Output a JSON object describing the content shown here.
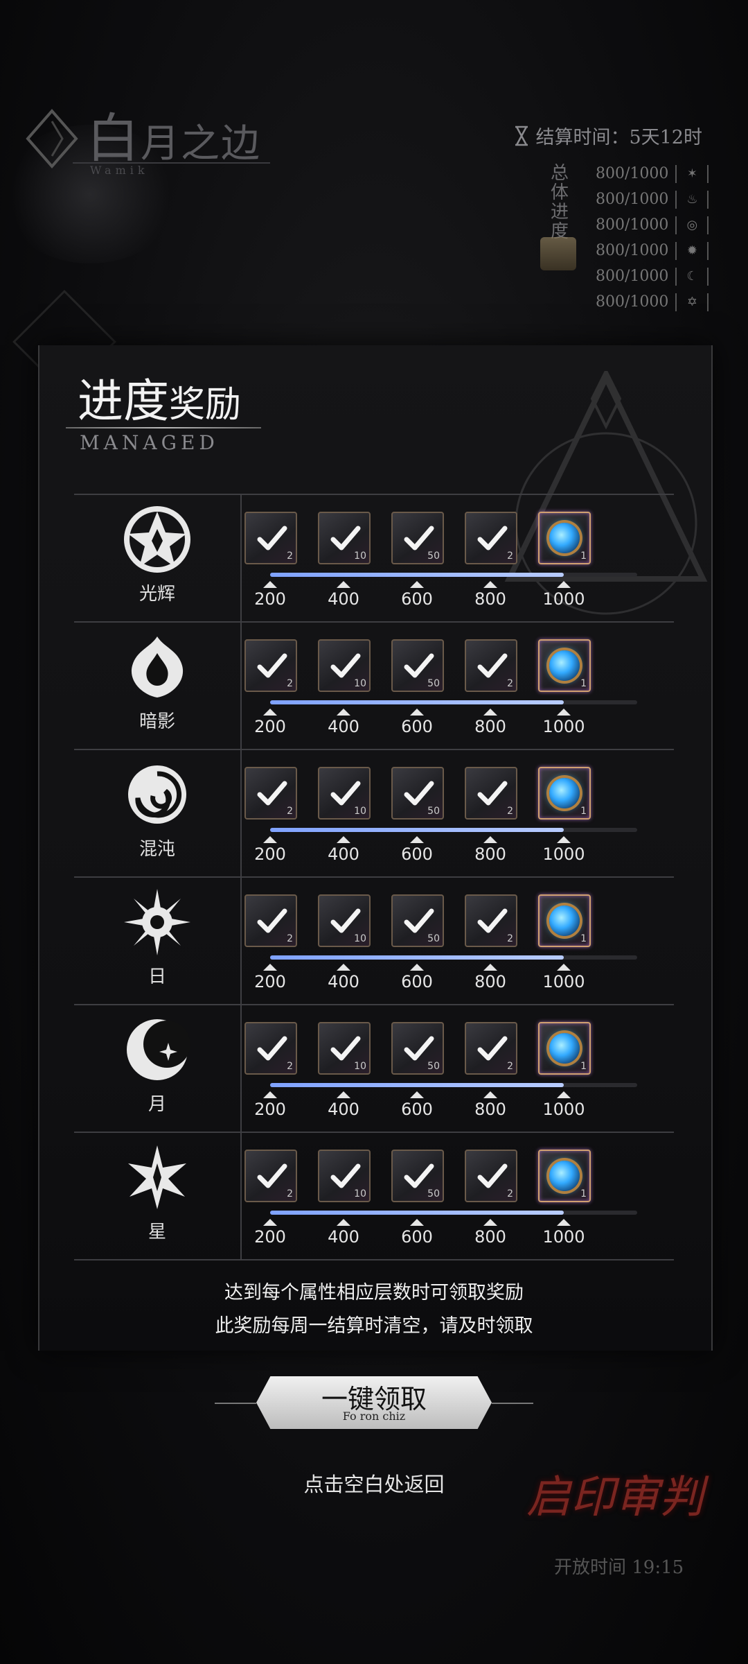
{
  "event": {
    "title_main": "白",
    "title_rest": "月之边",
    "subtitle": "Wamik",
    "settle_label": "结算时间：5天12时",
    "overall_label": "总体进度",
    "progress": [
      {
        "value": "800/1000",
        "icon": "radiance-icon"
      },
      {
        "value": "800/1000",
        "icon": "shadow-icon"
      },
      {
        "value": "800/1000",
        "icon": "chaos-icon"
      },
      {
        "value": "800/1000",
        "icon": "sun-icon"
      },
      {
        "value": "800/1000",
        "icon": "moon-icon"
      },
      {
        "value": "800/1000",
        "icon": "star-icon"
      }
    ]
  },
  "panel": {
    "title_big": "进度",
    "title_small": "奖励",
    "subtitle": "MANAGED",
    "rows": [
      {
        "name": "光辉",
        "icon": "radiance-icon",
        "progress": 0.8,
        "rewards": [
          {
            "qty": "2",
            "claimed": true
          },
          {
            "qty": "10",
            "claimed": true
          },
          {
            "qty": "50",
            "claimed": true
          },
          {
            "qty": "2",
            "claimed": true
          },
          {
            "qty": "1",
            "claimed": false
          }
        ]
      },
      {
        "name": "暗影",
        "icon": "shadow-icon",
        "progress": 0.8,
        "rewards": [
          {
            "qty": "2",
            "claimed": true
          },
          {
            "qty": "10",
            "claimed": true
          },
          {
            "qty": "50",
            "claimed": true
          },
          {
            "qty": "2",
            "claimed": true
          },
          {
            "qty": "1",
            "claimed": false
          }
        ]
      },
      {
        "name": "混沌",
        "icon": "chaos-icon",
        "progress": 0.8,
        "rewards": [
          {
            "qty": "2",
            "claimed": true
          },
          {
            "qty": "10",
            "claimed": true
          },
          {
            "qty": "50",
            "claimed": true
          },
          {
            "qty": "2",
            "claimed": true
          },
          {
            "qty": "1",
            "claimed": false
          }
        ]
      },
      {
        "name": "日",
        "icon": "sun-icon",
        "progress": 0.8,
        "rewards": [
          {
            "qty": "2",
            "claimed": true
          },
          {
            "qty": "10",
            "claimed": true
          },
          {
            "qty": "50",
            "claimed": true
          },
          {
            "qty": "2",
            "claimed": true
          },
          {
            "qty": "1",
            "claimed": false
          }
        ]
      },
      {
        "name": "月",
        "icon": "moon-icon",
        "progress": 0.8,
        "rewards": [
          {
            "qty": "2",
            "claimed": true
          },
          {
            "qty": "10",
            "claimed": true
          },
          {
            "qty": "50",
            "claimed": true
          },
          {
            "qty": "2",
            "claimed": true
          },
          {
            "qty": "1",
            "claimed": false
          }
        ]
      },
      {
        "name": "星",
        "icon": "star-icon",
        "progress": 0.8,
        "rewards": [
          {
            "qty": "2",
            "claimed": true
          },
          {
            "qty": "10",
            "claimed": true
          },
          {
            "qty": "50",
            "claimed": true
          },
          {
            "qty": "2",
            "claimed": true
          },
          {
            "qty": "1",
            "claimed": false
          }
        ]
      }
    ],
    "thresholds": [
      "200",
      "400",
      "600",
      "800",
      "1000"
    ],
    "note_line1": "达到每个属性相应层数时可领取奖励",
    "note_line2": "此奖励每周一结算时清空，请及时领取"
  },
  "claim_button": {
    "label": "一键领取",
    "sub": "Fo ron chiz"
  },
  "return_text": "点击空白处返回",
  "trial": {
    "logo": "启印审判",
    "open_time": "开放时间 19:15"
  },
  "colors": {
    "bar_fill": "#9fb8ff",
    "rare_border": "#e0a0f0",
    "panel_bg": "#131315"
  }
}
